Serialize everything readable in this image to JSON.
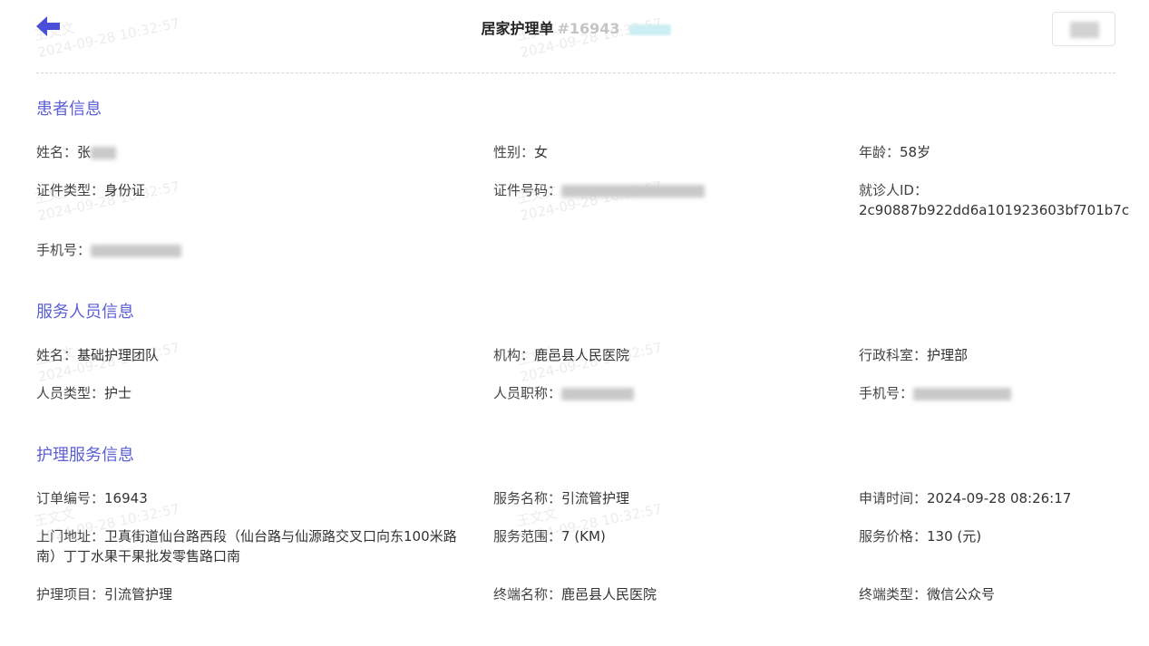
{
  "header": {
    "title": "居家护理单",
    "order_number": "#16943"
  },
  "patient": {
    "section_title": "患者信息",
    "name_label": "姓名：",
    "name_value": "张",
    "gender_label": "性别：",
    "gender_value": "女",
    "age_label": "年龄：",
    "age_value": "58岁",
    "id_type_label": "证件类型：",
    "id_type_value": "身份证",
    "id_number_label": "证件号码：",
    "visitor_id_label": "就诊人ID：",
    "visitor_id_value": "2c90887b922dd6a101923603bf701b7c",
    "phone_label": "手机号："
  },
  "staff": {
    "section_title": "服务人员信息",
    "name_label": "姓名：",
    "name_value": "基础护理团队",
    "org_label": "机构：",
    "org_value": "鹿邑县人民医院",
    "dept_label": "行政科室：",
    "dept_value": "护理部",
    "type_label": "人员类型：",
    "type_value": "护士",
    "title_label": "人员职称：",
    "phone_label": "手机号："
  },
  "service": {
    "section_title": "护理服务信息",
    "order_no_label": "订单编号：",
    "order_no_value": "16943",
    "service_name_label": "服务名称：",
    "service_name_value": "引流管护理",
    "apply_time_label": "申请时间：",
    "apply_time_value": "2024-09-28 08:26:17",
    "address_label": "上门地址：",
    "address_value": "卫真街道仙台路西段（仙台路与仙源路交叉口向东100米路南）丁丁水果干果批发零售路口南",
    "range_label": "服务范围：",
    "range_value": "7 (KM)",
    "price_label": "服务价格：",
    "price_value": "130 (元)",
    "item_label": "护理项目：",
    "item_value": "引流管护理",
    "terminal_name_label": "终端名称：",
    "terminal_name_value": "鹿邑县人民医院",
    "terminal_type_label": "终端类型：",
    "terminal_type_value": "微信公众号"
  },
  "colors": {
    "accent": "#5a5fd6",
    "back_arrow": "#4a4fd8"
  },
  "watermark": {
    "name": "王文文",
    "timestamp": "2024-09-28 10:32:57"
  }
}
